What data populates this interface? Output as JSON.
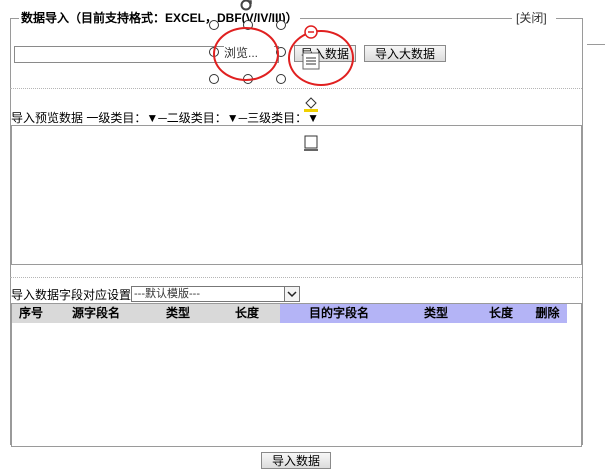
{
  "dialog": {
    "title": "数据导入（目前支持格式：EXCEL，DBF(V/IV/III)）",
    "close_label": "[关闭]"
  },
  "file_row": {
    "browse_label": "浏览...",
    "import_label": "导入数据",
    "import_big_label": "导入大数据"
  },
  "preview": {
    "label": "导入预览数据 一级类目：▼─二级类目：▼─三级类目：▼"
  },
  "mapping": {
    "label": "导入数据字段对应设置",
    "template_selected": "---默认模版---"
  },
  "grid": {
    "columns": [
      {
        "label": "序号",
        "style": "dark"
      },
      {
        "label": "源字段名",
        "style": "dark"
      },
      {
        "label": "类型",
        "style": "dark"
      },
      {
        "label": "长度",
        "style": "dark"
      },
      {
        "label": "目的字段名",
        "style": "blue"
      },
      {
        "label": "类型",
        "style": "blue"
      },
      {
        "label": "长度",
        "style": "blue"
      },
      {
        "label": "删除",
        "style": "blue"
      }
    ]
  },
  "footer": {
    "import_label": "导入数据"
  },
  "overlay": {
    "highlight_color": "#e02020",
    "icons": [
      "rotate-handle-icon",
      "remove-icon",
      "text-format-icon",
      "fill-color-icon",
      "border-icon"
    ]
  }
}
